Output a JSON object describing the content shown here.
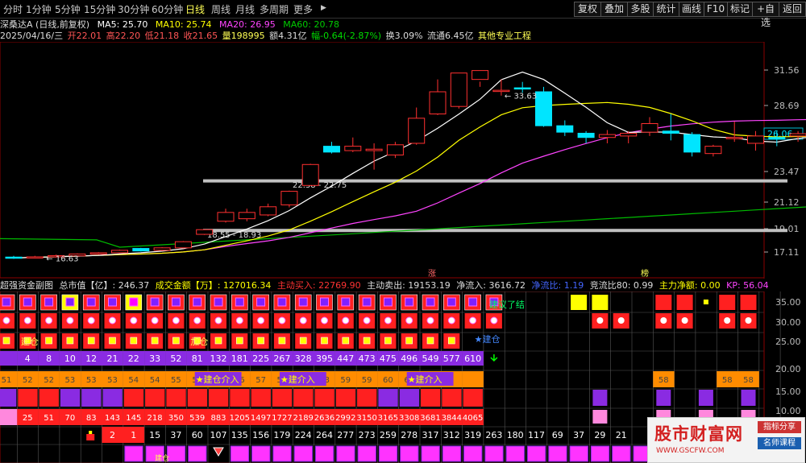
{
  "toolbar": {
    "periods": [
      "分时",
      "1分钟",
      "5分钟",
      "15分钟",
      "30分钟",
      "60分钟",
      "日线",
      "周线",
      "月线",
      "多周期",
      "更多"
    ],
    "active_period": "日线",
    "more_arrow": "▶",
    "right_buttons": [
      "复权",
      "叠加",
      "多股",
      "统计",
      "画线",
      "F10",
      "标记",
      "+自选",
      "返回"
    ]
  },
  "stock": {
    "name_line": "深桑达A (日线,前复权)",
    "date": "2025/04/16/三",
    "open": "开22.01",
    "high": "高22.20",
    "low": "低21.18",
    "close": "收21.65",
    "volume": "量198995",
    "amount": "额4.31亿",
    "change": "幅-0.64(-2.87%)",
    "turnover": "换3.09%",
    "float": "流通6.45亿",
    "industry": "其他专业工程"
  },
  "ma": {
    "ma5": "MA5: 25.70",
    "ma10": "MA10: 25.74",
    "ma20": "MA20: 26.95",
    "ma60": "MA60: 20.78",
    "colors": {
      "ma5": "#ffffff",
      "ma10": "#ffff00",
      "ma20": "#ff44ff",
      "ma60": "#00cc00"
    }
  },
  "price_axis": {
    "labels": [
      "31.56",
      "28.69",
      "26.06",
      "23.47",
      "21.12",
      "19.01",
      "17.11"
    ],
    "current_price": "26.06"
  },
  "annotations": {
    "high": "33.63",
    "low": "16.63",
    "zone_upper": "22.38 - 22.75",
    "zone_lower": "18.55 - 18.93",
    "zhang": "涨",
    "bang": "榜"
  },
  "chart_data": {
    "type": "candlestick",
    "series": [
      {
        "o": 16.7,
        "h": 16.8,
        "l": 16.55,
        "c": 16.63
      },
      {
        "o": 16.65,
        "h": 16.8,
        "l": 16.6,
        "c": 16.72
      },
      {
        "o": 16.72,
        "h": 16.9,
        "l": 16.65,
        "c": 16.82
      },
      {
        "o": 16.8,
        "h": 17.0,
        "l": 16.75,
        "c": 16.95
      },
      {
        "o": 16.95,
        "h": 17.1,
        "l": 16.9,
        "c": 17.05
      },
      {
        "o": 17.05,
        "h": 17.3,
        "l": 17.0,
        "c": 17.25
      },
      {
        "o": 17.4,
        "h": 17.45,
        "l": 17.15,
        "c": 17.2
      },
      {
        "o": 17.25,
        "h": 17.5,
        "l": 17.2,
        "c": 17.45
      },
      {
        "o": 17.45,
        "h": 18.0,
        "l": 17.4,
        "c": 17.95
      },
      {
        "o": 18.55,
        "h": 18.93,
        "l": 18.5,
        "c": 18.93
      },
      {
        "o": 19.6,
        "h": 20.6,
        "l": 19.5,
        "c": 20.3
      },
      {
        "o": 19.8,
        "h": 20.6,
        "l": 19.6,
        "c": 20.3
      },
      {
        "o": 20.1,
        "h": 21.0,
        "l": 20.0,
        "c": 20.75
      },
      {
        "o": 20.9,
        "h": 22.0,
        "l": 20.7,
        "c": 21.95
      },
      {
        "o": 22.4,
        "h": 24.0,
        "l": 22.38,
        "c": 23.95
      },
      {
        "o": 25.2,
        "h": 25.5,
        "l": 24.7,
        "c": 24.8
      },
      {
        "o": 24.9,
        "h": 25.8,
        "l": 24.8,
        "c": 25.2
      },
      {
        "o": 24.9,
        "h": 25.4,
        "l": 23.6,
        "c": 25.0
      },
      {
        "o": 24.6,
        "h": 25.5,
        "l": 24.4,
        "c": 25.3
      },
      {
        "o": 25.4,
        "h": 28.5,
        "l": 25.3,
        "c": 27.5
      },
      {
        "o": 27.9,
        "h": 30.8,
        "l": 27.8,
        "c": 29.8
      },
      {
        "o": 28.6,
        "h": 32.3,
        "l": 28.4,
        "c": 31.8
      },
      {
        "o": 30.8,
        "h": 32.5,
        "l": 30.2,
        "c": 31.6
      },
      {
        "o": 31.0,
        "h": 33.63,
        "l": 30.8,
        "c": 33.2
      },
      {
        "o": 33.0,
        "h": 33.4,
        "l": 30.6,
        "c": 30.6
      },
      {
        "o": 29.8,
        "h": 30.2,
        "l": 26.7,
        "c": 26.8
      },
      {
        "o": 26.8,
        "h": 27.3,
        "l": 25.9,
        "c": 26.2
      },
      {
        "o": 26.1,
        "h": 26.3,
        "l": 25.4,
        "c": 25.8
      },
      {
        "o": 25.8,
        "h": 26.4,
        "l": 25.4,
        "c": 26.0
      },
      {
        "o": 25.9,
        "h": 26.3,
        "l": 25.4,
        "c": 26.1
      },
      {
        "o": 26.2,
        "h": 27.6,
        "l": 25.9,
        "c": 27.0
      },
      {
        "o": 26.3,
        "h": 27.9,
        "l": 25.6,
        "c": 26.1
      },
      {
        "o": 26.0,
        "h": 26.2,
        "l": 24.5,
        "c": 24.8
      },
      {
        "o": 24.7,
        "h": 25.3,
        "l": 24.5,
        "c": 25.2
      },
      {
        "o": 25.8,
        "h": 27.2,
        "l": 25.5,
        "c": 25.8
      },
      {
        "o": 25.4,
        "h": 26.3,
        "l": 24.9,
        "c": 25.9
      },
      {
        "o": 25.8,
        "h": 26.3,
        "l": 25.2,
        "c": 25.7
      },
      {
        "o": 25.9,
        "h": 26.3,
        "l": 25.5,
        "c": 26.06
      },
      {
        "o": 25.9,
        "h": 26.6,
        "l": 25.7,
        "c": 26.0
      }
    ]
  },
  "indicator": {
    "title": "超强资金副图",
    "market_cap": "总市值【亿】: 246.37",
    "turnover_amount": "成交金额【万】: 127016.34",
    "main_buy": "主动买入: 22769.90",
    "main_sell": "主动卖出: 19153.19",
    "net_inflow": "净流入: 3616.72",
    "net_ratio": "净流比: 1.19",
    "bid_ratio": "竞流比80: 0.99",
    "main_net": "主力净额: 0.00",
    "kp": "KP: 56.04",
    "axis": [
      "35.00",
      "30.00",
      "25.00",
      "20.00",
      "15.00",
      "10.00",
      "5.00",
      "0.00"
    ],
    "labels": {
      "suggest": "建议了结",
      "build1": "建仓",
      "build2": "加仓",
      "build3": "建仓",
      "intro1": "★建仓介入",
      "intro2": "★建介入",
      "intro3": "★建介入",
      "bottom": "建仓"
    },
    "row3_values": [
      "4",
      "8",
      "10",
      "12",
      "21",
      "22",
      "33",
      "52",
      "81",
      "132",
      "181",
      "225",
      "267",
      "328",
      "395",
      "447",
      "473",
      "475",
      "496",
      "549",
      "577",
      "610"
    ],
    "row4_values": [
      "51",
      "52",
      "52",
      "53",
      "53",
      "53",
      "54",
      "54",
      "55",
      "55",
      "56",
      "56",
      "57",
      "57",
      "58",
      "58",
      "59",
      "59",
      "60",
      "60",
      "58",
      "58",
      "58"
    ],
    "row6_values": [
      "25",
      "51",
      "70",
      "83",
      "143",
      "145",
      "218",
      "350",
      "539",
      "883",
      "1205",
      "1497",
      "1727",
      "2189",
      "2636",
      "2992",
      "3150",
      "3165",
      "3308",
      "3681",
      "3844",
      "4065"
    ],
    "row7_values": [
      "2",
      "1",
      "15",
      "37",
      "60",
      "107",
      "135",
      "156",
      "179",
      "224",
      "264",
      "277",
      "273",
      "259",
      "278",
      "317",
      "312",
      "319",
      "263",
      "180",
      "117",
      "69",
      "37",
      "29",
      "21"
    ]
  },
  "watermark": {
    "name": "股市财富网",
    "url": "WWW.GSCFW.COM",
    "tag1": "指标分享",
    "tag2": "名师课程"
  }
}
